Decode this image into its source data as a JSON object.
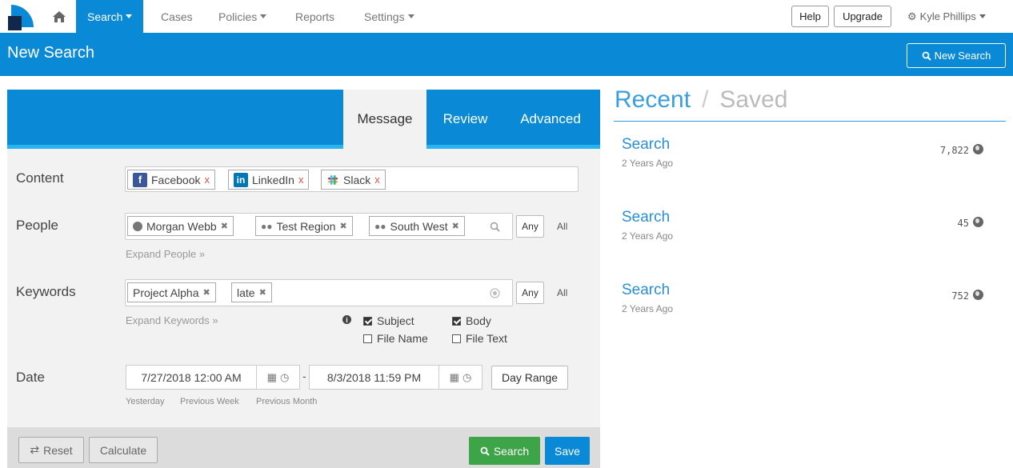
{
  "nav": {
    "home_icon": "home-icon",
    "items": [
      {
        "label": "Search",
        "has_caret": true
      },
      {
        "label": "Cases"
      },
      {
        "label": "Policies",
        "has_caret": true
      },
      {
        "label": "Reports"
      },
      {
        "label": "Settings",
        "has_caret": true
      }
    ],
    "help_label": "Help",
    "upgrade_label": "Upgrade",
    "user_name": "Kyle Phillips"
  },
  "header": {
    "title": "New Search",
    "new_search_label": "New Search"
  },
  "tabs": [
    "Message",
    "Review",
    "Advanced"
  ],
  "form": {
    "content": {
      "label": "Content",
      "tags": [
        {
          "label": "Facebook",
          "icon": "facebook-icon",
          "color": "#3b5998"
        },
        {
          "label": "LinkedIn",
          "icon": "linkedin-icon",
          "color": "#0077b5"
        },
        {
          "label": "Slack",
          "icon": "slack-icon",
          "color": "#e01e5a"
        }
      ],
      "remove_glyph": "x"
    },
    "people": {
      "label": "People",
      "tags": [
        "Morgan Webb",
        "Test Region",
        "South West"
      ],
      "expand_link": "Expand People »",
      "any_label": "Any",
      "all_label": "All"
    },
    "keywords": {
      "label": "Keywords",
      "tags": [
        "Project Alpha",
        "late"
      ],
      "expand_link": "Expand Keywords »",
      "any_label": "Any",
      "all_label": "All",
      "checks": [
        {
          "label": "Subject",
          "checked": true
        },
        {
          "label": "Body",
          "checked": true
        },
        {
          "label": "File Name",
          "checked": false
        },
        {
          "label": "File Text",
          "checked": false
        }
      ]
    },
    "date": {
      "label": "Date",
      "start": "7/27/2018 12:00 AM",
      "end": "8/3/2018 11:59 PM",
      "separator": "-",
      "range_label": "Day Range",
      "quick": [
        "Yesterday",
        "Previous Week",
        "Previous Month"
      ]
    }
  },
  "footer": {
    "reset_label": "Reset",
    "calculate_label": "Calculate",
    "search_label": "Search",
    "save_label": "Save"
  },
  "recent": {
    "recent_label": "Recent",
    "separator": "/",
    "saved_label": "Saved",
    "items": [
      {
        "name": "Search",
        "when": "2 Years Ago",
        "count": "7,822"
      },
      {
        "name": "Search",
        "when": "2 Years Ago",
        "count": "45"
      },
      {
        "name": "Search",
        "when": "2 Years Ago",
        "count": "752"
      }
    ]
  },
  "colors": {
    "accent": "#0a8ad6",
    "stripe": "#2ab4ef",
    "search_green": "#3da447"
  }
}
